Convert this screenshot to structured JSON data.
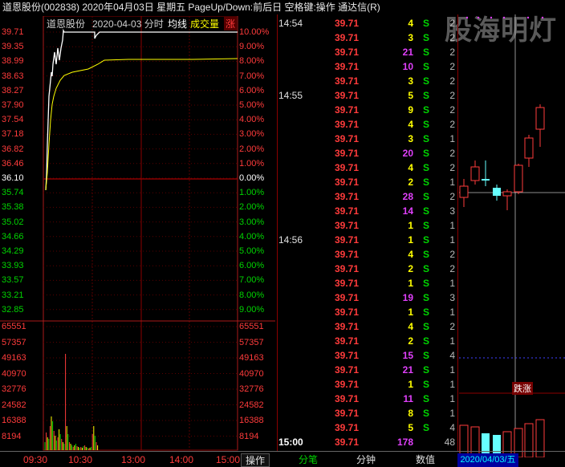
{
  "title": "道恩股份(002838)  2020年04月03日 星期五 PageUp/Down:前后日 空格键:操作 通达信(R)",
  "watermark": "股海明灯",
  "chart": {
    "stock_name": "道恩股份",
    "date_label": "2020-04-03 分时",
    "legend_avg": "均线",
    "legend_vol": "成交量",
    "legend_extra": "涨",
    "price_labels": [
      "39.71",
      "39.35",
      "38.99",
      "38.63",
      "38.27",
      "37.90",
      "37.54",
      "37.18",
      "36.82",
      "36.46",
      "36.10",
      "35.74",
      "35.38",
      "35.02",
      "34.66",
      "34.29",
      "33.93",
      "33.57",
      "33.21",
      "32.85"
    ],
    "pct_labels": [
      "10.00%",
      "9.00%",
      "8.00%",
      "7.00%",
      "6.00%",
      "5.00%",
      "4.00%",
      "3.00%",
      "2.00%",
      "1.00%",
      "0.00%",
      "1.00%",
      "2.00%",
      "3.00%",
      "4.00%",
      "5.00%",
      "6.00%",
      "7.00%",
      "8.00%",
      "9.00%"
    ],
    "volume_labels": [
      "65551",
      "57357",
      "49163",
      "40970",
      "32776",
      "24582",
      "16388",
      "8194"
    ],
    "time_labels": [
      "09:30",
      "10:30",
      "13:00",
      "14:00",
      "15:00"
    ],
    "colors": {
      "up": "#ff3b3b",
      "down": "#00d400",
      "flat": "#ffffff",
      "price_line": "#ffffff",
      "avg_line": "#ffff00",
      "grid": "#8b0000"
    }
  },
  "ticks": [
    {
      "time": "14:54",
      "price": "39.71",
      "vol": "4",
      "side": "S",
      "n": "2",
      "vol_color": "#ffff00"
    },
    {
      "time": "",
      "price": "39.71",
      "vol": "3",
      "side": "S",
      "n": "2",
      "vol_color": "#ffff00"
    },
    {
      "time": "",
      "price": "39.71",
      "vol": "21",
      "side": "S",
      "n": "2",
      "vol_color": "#e040fb"
    },
    {
      "time": "",
      "price": "39.71",
      "vol": "10",
      "side": "S",
      "n": "2",
      "vol_color": "#e040fb"
    },
    {
      "time": "",
      "price": "39.71",
      "vol": "3",
      "side": "S",
      "n": "2",
      "vol_color": "#ffff00"
    },
    {
      "time": "14:55",
      "price": "39.71",
      "vol": "5",
      "side": "S",
      "n": "2",
      "vol_color": "#ffff00"
    },
    {
      "time": "",
      "price": "39.71",
      "vol": "9",
      "side": "S",
      "n": "2",
      "vol_color": "#ffff00"
    },
    {
      "time": "",
      "price": "39.71",
      "vol": "4",
      "side": "S",
      "n": "2",
      "vol_color": "#ffff00"
    },
    {
      "time": "",
      "price": "39.71",
      "vol": "3",
      "side": "S",
      "n": "1",
      "vol_color": "#ffff00"
    },
    {
      "time": "",
      "price": "39.71",
      "vol": "20",
      "side": "S",
      "n": "2",
      "vol_color": "#e040fb"
    },
    {
      "time": "",
      "price": "39.71",
      "vol": "4",
      "side": "S",
      "n": "2",
      "vol_color": "#ffff00"
    },
    {
      "time": "",
      "price": "39.71",
      "vol": "2",
      "side": "S",
      "n": "1",
      "vol_color": "#ffff00"
    },
    {
      "time": "",
      "price": "39.71",
      "vol": "28",
      "side": "S",
      "n": "2",
      "vol_color": "#e040fb"
    },
    {
      "time": "",
      "price": "39.71",
      "vol": "14",
      "side": "S",
      "n": "3",
      "vol_color": "#e040fb"
    },
    {
      "time": "",
      "price": "39.71",
      "vol": "1",
      "side": "S",
      "n": "1",
      "vol_color": "#ffff00"
    },
    {
      "time": "14:56",
      "price": "39.71",
      "vol": "1",
      "side": "S",
      "n": "1",
      "vol_color": "#ffff00"
    },
    {
      "time": "",
      "price": "39.71",
      "vol": "4",
      "side": "S",
      "n": "2",
      "vol_color": "#ffff00"
    },
    {
      "time": "",
      "price": "39.71",
      "vol": "2",
      "side": "S",
      "n": "2",
      "vol_color": "#ffff00"
    },
    {
      "time": "",
      "price": "39.71",
      "vol": "1",
      "side": "S",
      "n": "1",
      "vol_color": "#ffff00"
    },
    {
      "time": "",
      "price": "39.71",
      "vol": "19",
      "side": "S",
      "n": "3",
      "vol_color": "#e040fb"
    },
    {
      "time": "",
      "price": "39.71",
      "vol": "1",
      "side": "S",
      "n": "1",
      "vol_color": "#ffff00"
    },
    {
      "time": "",
      "price": "39.71",
      "vol": "4",
      "side": "S",
      "n": "2",
      "vol_color": "#ffff00"
    },
    {
      "time": "",
      "price": "39.71",
      "vol": "2",
      "side": "S",
      "n": "1",
      "vol_color": "#ffff00"
    },
    {
      "time": "",
      "price": "39.71",
      "vol": "15",
      "side": "S",
      "n": "4",
      "vol_color": "#e040fb"
    },
    {
      "time": "",
      "price": "39.71",
      "vol": "21",
      "side": "S",
      "n": "1",
      "vol_color": "#e040fb"
    },
    {
      "time": "",
      "price": "39.71",
      "vol": "1",
      "side": "S",
      "n": "1",
      "vol_color": "#ffff00"
    },
    {
      "time": "",
      "price": "39.71",
      "vol": "11",
      "side": "S",
      "n": "1",
      "vol_color": "#e040fb"
    },
    {
      "time": "",
      "price": "39.71",
      "vol": "8",
      "side": "S",
      "n": "1",
      "vol_color": "#ffff00"
    },
    {
      "time": "",
      "price": "39.71",
      "vol": "5",
      "side": "S",
      "n": "4",
      "vol_color": "#ffff00"
    },
    {
      "time": "15:00",
      "price": "39.71",
      "vol": "178",
      "side": "",
      "n": "48",
      "vol_color": "#e040fb"
    }
  ],
  "kline": {
    "tooltip": "跌涨",
    "date_label": "2020/04/03/五"
  },
  "bottom": {
    "operate": "操作",
    "tabs": [
      "分笔",
      "分钟",
      "数值"
    ]
  }
}
